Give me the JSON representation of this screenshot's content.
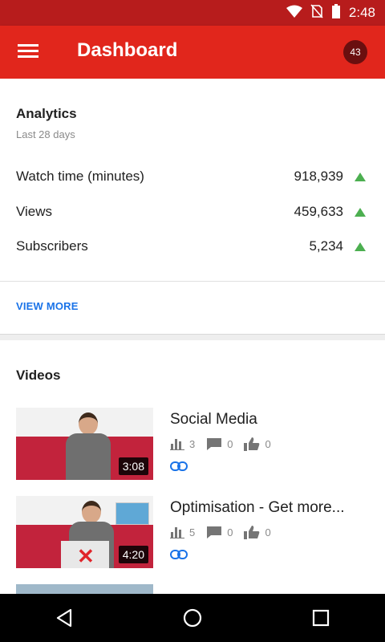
{
  "status_bar": {
    "time": "2:48"
  },
  "toolbar": {
    "title": "Dashboard",
    "badge_count": "43"
  },
  "analytics": {
    "title": "Analytics",
    "period": "Last 28 days",
    "metrics": [
      {
        "label": "Watch time (minutes)",
        "value": "918,939",
        "trend": "up"
      },
      {
        "label": "Views",
        "value": "459,633",
        "trend": "up"
      },
      {
        "label": "Subscribers",
        "value": "5,234",
        "trend": "up"
      }
    ],
    "view_more_label": "VIEW MORE"
  },
  "videos": {
    "title": "Videos",
    "items": [
      {
        "title": "Social Media",
        "duration": "3:08",
        "views": "3",
        "comments": "0",
        "likes": "0"
      },
      {
        "title": "Optimisation - Get more...",
        "duration": "4:20",
        "views": "5",
        "comments": "0",
        "likes": "0"
      }
    ]
  },
  "colors": {
    "toolbar": "#e1261c",
    "status_bar": "#b71c1c",
    "trend_up": "#4caf50",
    "link": "#1a73e8"
  },
  "icons": [
    "wifi-icon",
    "no-sim-icon",
    "battery-icon",
    "menu-icon",
    "bar-chart-icon",
    "comment-icon",
    "thumb-up-icon",
    "link-icon",
    "back-icon",
    "home-icon",
    "recents-icon"
  ]
}
